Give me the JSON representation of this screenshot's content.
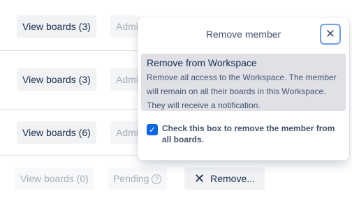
{
  "rows": [
    {
      "view_label": "View boards (3)",
      "role_label": "Admin"
    },
    {
      "view_label": "View boards (3)",
      "role_label": "Admin"
    },
    {
      "view_label": "View boards (6)",
      "role_label": "Admin"
    },
    {
      "view_label": "View boards (0)",
      "role_label": "Pending",
      "remove_label": "Remove..."
    }
  ],
  "popover": {
    "title": "Remove member",
    "close_icon": "close-icon",
    "option_title": "Remove from Workspace",
    "option_description": "Remove all access to the Workspace. The member will remain on all their boards in this Workspace. They will receive a notification.",
    "checkbox_label": "Check this box to remove the member from all boards.",
    "checkbox_checked": true
  },
  "colors": {
    "accent": "#0c66e4",
    "focus_ring": "#6f9fe6"
  }
}
